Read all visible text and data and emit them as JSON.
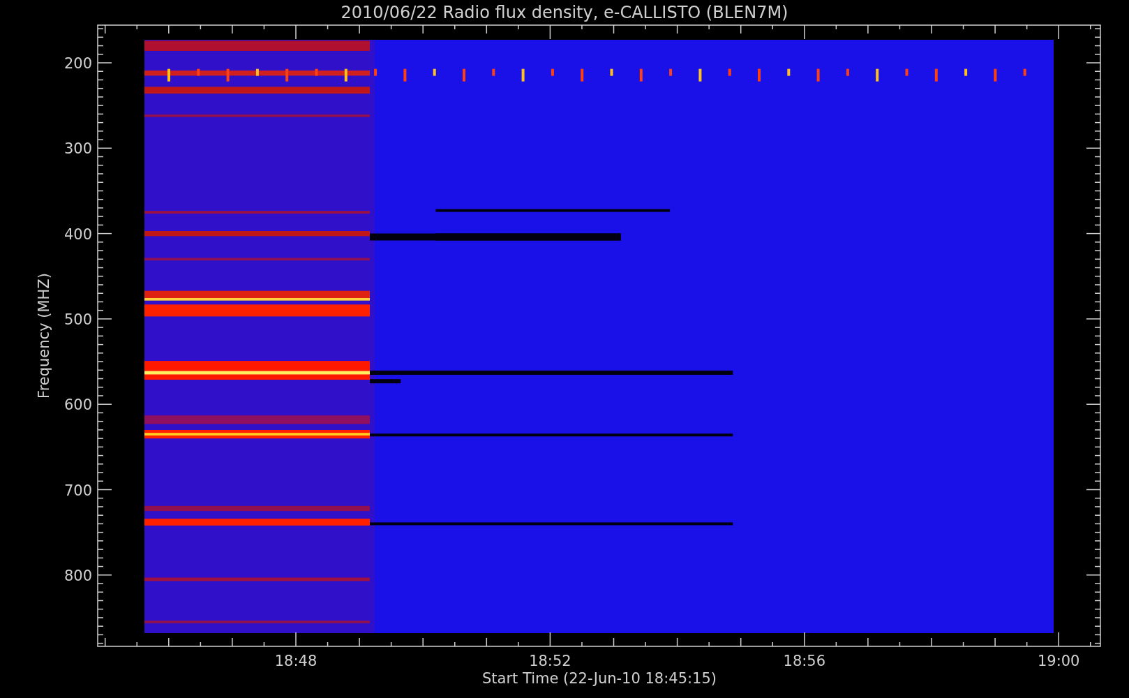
{
  "plot": {
    "title": "2010/06/22  Radio flux density, e-CALLISTO (BLEN7M)",
    "ylabel": "Frequency (MHZ)",
    "xlabel": "Start Time (22-Jun-10 18:45:15)",
    "yticks": [
      "200",
      "300",
      "400",
      "500",
      "600",
      "700",
      "800"
    ],
    "xticks": [
      "18:48",
      "18:52",
      "18:56",
      "19:00"
    ]
  }
}
